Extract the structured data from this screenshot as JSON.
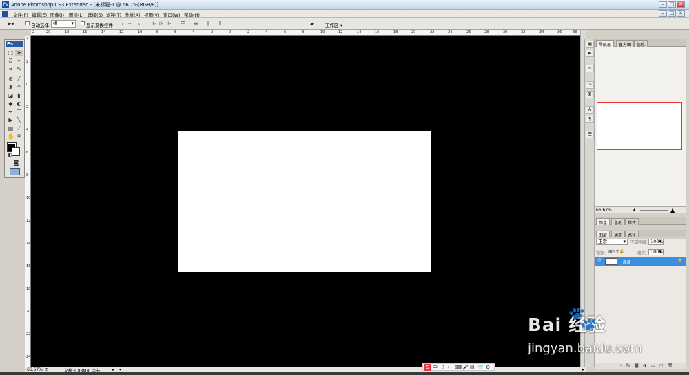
{
  "window": {
    "title": "Adobe Photoshop CS3 Extended - [未标题-1 @ 66.7%(RGB/8)]"
  },
  "menu": [
    "文件(F)",
    "编辑(E)",
    "图像(I)",
    "图层(L)",
    "选择(S)",
    "滤镜(T)",
    "分析(A)",
    "视图(V)",
    "窗口(W)",
    "帮助(H)"
  ],
  "options": {
    "auto_select_label": "自动选择:",
    "auto_select_value": "组",
    "show_transform_label": "显示变换控件",
    "workspace_label": "工作区 ▾"
  },
  "ruler_top": [
    "2",
    "20",
    "18",
    "16",
    "14",
    "12",
    "10",
    "8",
    "6",
    "4",
    "2",
    "0",
    "2",
    "4",
    "6",
    "8",
    "10",
    "12",
    "14",
    "16",
    "18",
    "20",
    "22",
    "24",
    "26",
    "28",
    "30",
    "32",
    "34",
    "36",
    "38"
  ],
  "ruler_left": [
    "4",
    "2",
    "0",
    "2",
    "4",
    "6",
    "8",
    "10",
    "12",
    "14",
    "16",
    "18",
    "20",
    "22",
    "24"
  ],
  "toolbox": {
    "logo": "Ps"
  },
  "panels": {
    "nav_tabs": [
      "导航器",
      "直方图",
      "信息"
    ],
    "nav_zoom": "66.67%",
    "color_tabs": [
      "颜色",
      "色板",
      "样式"
    ],
    "layer_tabs": [
      "图层",
      "通道",
      "路径"
    ],
    "blend_mode": "正常",
    "opacity_label": "不透明度:",
    "opacity_value": "100%",
    "lock_label": "锁定:",
    "fill_label": "填充:",
    "fill_value": "100%",
    "layer_name": "背景"
  },
  "status": {
    "zoom": "66.67%",
    "doc_info": "文档:1.83M/0 字节"
  },
  "ime": {
    "items": [
      "S",
      "中",
      "☽",
      "•,",
      "⌨",
      "🎤",
      "▤",
      "👕",
      "⚙"
    ]
  },
  "watermark": {
    "brand": "Bai  经验",
    "url": "jingyan.baidu.com",
    "paw": "🐾"
  },
  "colors": {
    "canvas_bg": "#000000",
    "selection_blue": "#3b8fe0",
    "nav_proxy": "#ee3333"
  }
}
